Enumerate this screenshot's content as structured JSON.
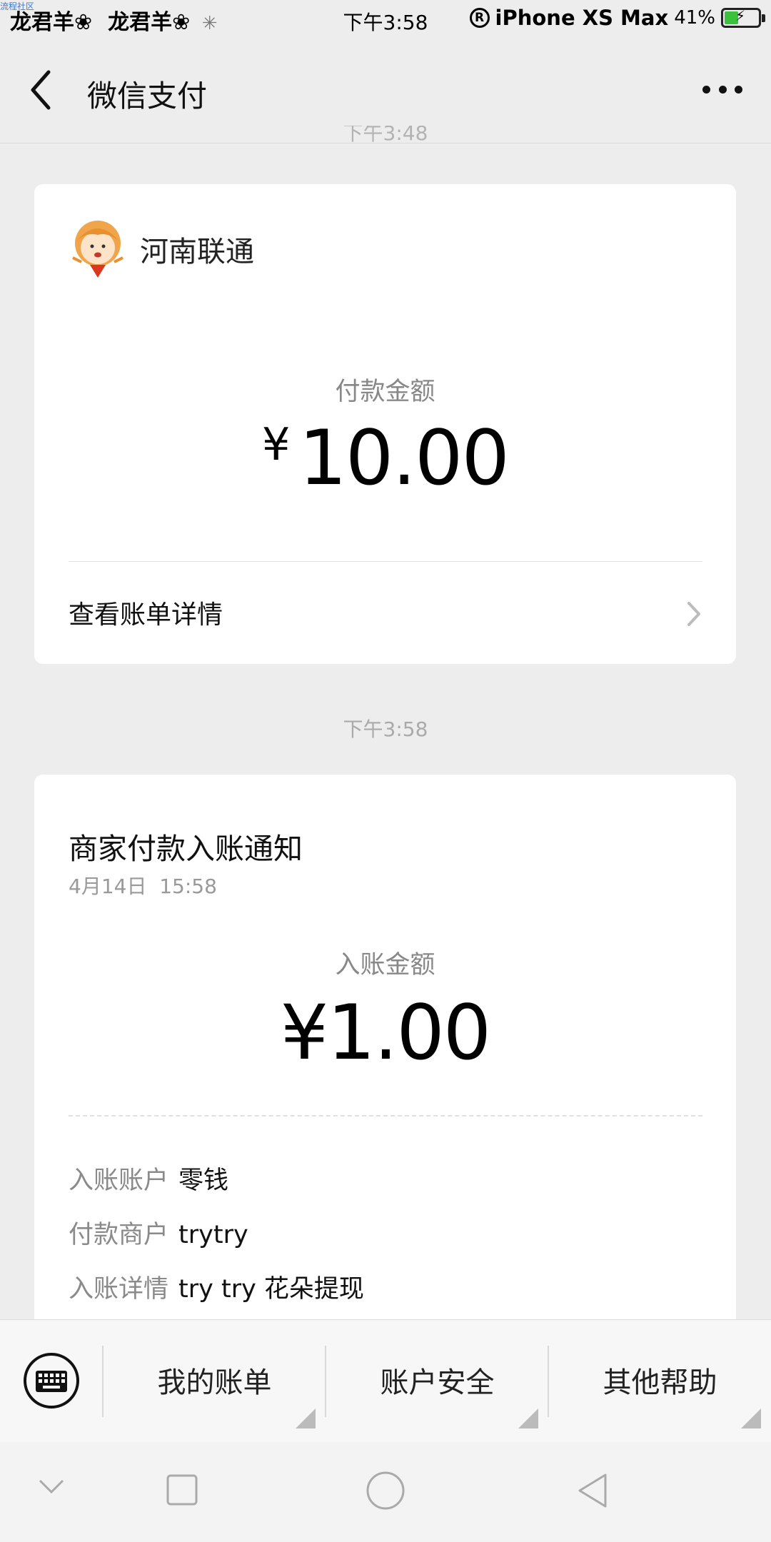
{
  "status_bar": {
    "corner_text": "流程社区",
    "left_text_1": "龙君羊❀",
    "left_text_2": "龙君羊❀",
    "time": "下午3:58",
    "registered_mark": "R",
    "carrier": "iPhone XS Max",
    "battery_percent": "41%",
    "battery_level": 0.41
  },
  "nav": {
    "title": "微信支付"
  },
  "faded_time": "下午3:48",
  "payment_card": {
    "merchant_name": "河南联通",
    "amount_label": "付款金额",
    "currency_symbol": "¥",
    "amount": "10.00",
    "detail_link": "查看账单详情"
  },
  "time_separator": "下午3:58",
  "notice_card": {
    "title": "商家付款入账通知",
    "date": "4月14日  15:58",
    "amount_label": "入账金额",
    "amount": "¥1.00",
    "rows": [
      {
        "label": "入账账户",
        "value": "零钱"
      },
      {
        "label": "付款商户",
        "value": "trytry"
      },
      {
        "label": "入账详情",
        "value": "try try 花朵提现"
      }
    ]
  },
  "bottom_menu": {
    "items": [
      "我的账单",
      "账户安全",
      "其他帮助"
    ]
  },
  "colors": {
    "background": "#ededed",
    "card": "#ffffff",
    "battery_green": "#3cc13c"
  }
}
